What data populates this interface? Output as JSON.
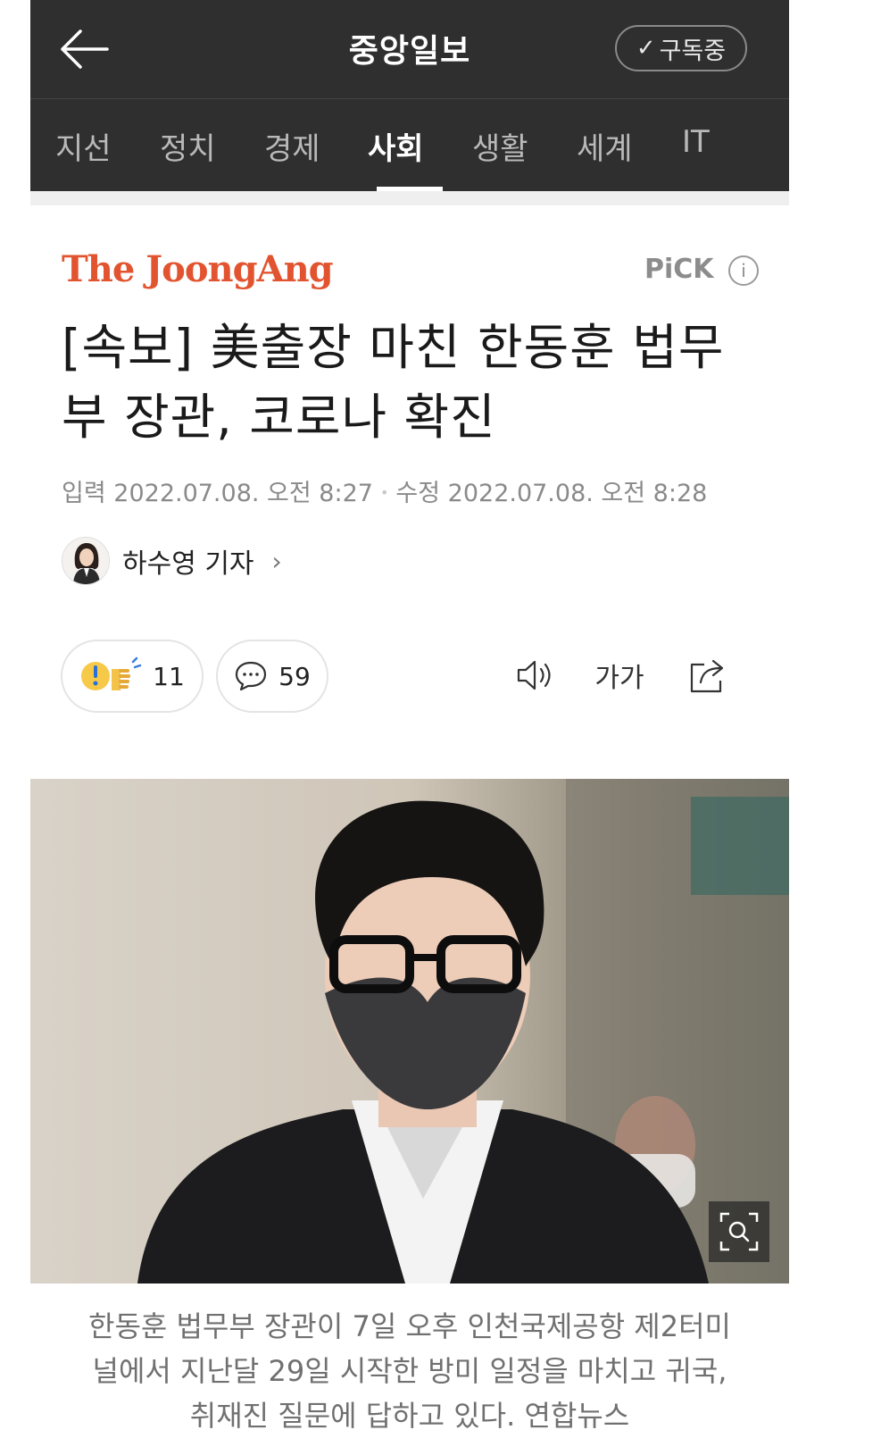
{
  "header": {
    "title": "중앙일보",
    "subscribe_label": "구독중"
  },
  "tabs": [
    {
      "label": "지선",
      "active": false
    },
    {
      "label": "정치",
      "active": false
    },
    {
      "label": "경제",
      "active": false
    },
    {
      "label": "사회",
      "active": true
    },
    {
      "label": "생활",
      "active": false
    },
    {
      "label": "세계",
      "active": false
    },
    {
      "label": "IT",
      "active": false
    }
  ],
  "article": {
    "press_logo": "The JoongAng",
    "pick_label": "PiCK",
    "info_icon": "i",
    "headline": "[속보] 美출장 마친 한동훈 법무부 장관, 코로나 확진",
    "input_label": "입력",
    "input_date": "2022.07.08. 오전 8:27",
    "modified_label": "수정",
    "modified_date": "2022.07.08. 오전 8:28",
    "author": "하수영 기자",
    "reaction_count": "11",
    "comment_count": "59",
    "font_size_label": "가가",
    "caption": "한동훈 법무부 장관이 7일 오후 인천국제공항 제2터미널에서 지난달 29일 시작한 방미 일정을 마치고 귀국, 취재진 질문에 답하고 있다. 연합뉴스"
  },
  "icons": {
    "back": "arrow-left-icon",
    "check": "check-icon",
    "reaction": "reaction-emoji-icon",
    "comment": "speech-bubble-icon",
    "speaker": "speaker-icon",
    "font_size": "font-size-icon",
    "share": "share-icon",
    "zoom": "zoom-search-icon"
  },
  "colors": {
    "header_bg": "#2f2f2f",
    "brand_red": "#e2542f",
    "meta_gray": "#8a8a8a"
  }
}
